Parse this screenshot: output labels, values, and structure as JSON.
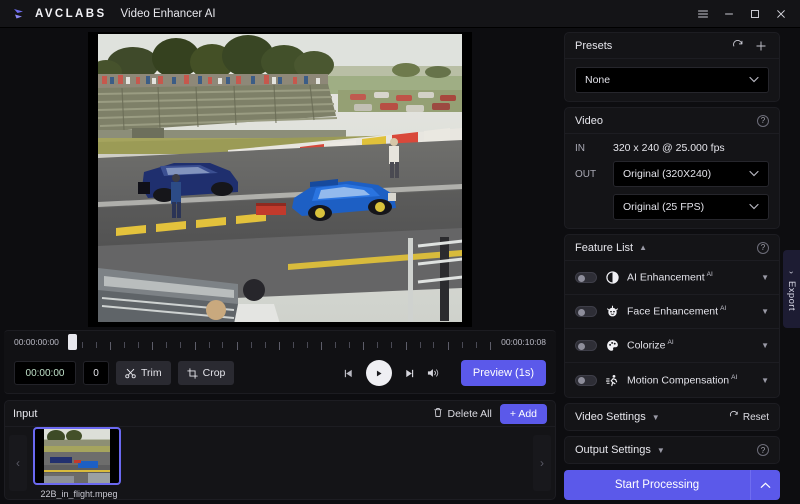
{
  "titlebar": {
    "brand": "AVCLABS",
    "logo_icon": "avclabs-logo-icon",
    "app_title": "Video Enhancer AI",
    "menu_icon": "hamburger-menu-icon",
    "minimize_icon": "minimize-icon",
    "maximize_icon": "maximize-icon",
    "close_icon": "close-icon"
  },
  "player": {
    "start_timecode": "00:00:00:00",
    "end_timecode": "00:00:10:08",
    "current_timecode": "00:00:00",
    "frame_number": "0",
    "trim_label": "Trim",
    "trim_icon": "scissors-icon",
    "crop_label": "Crop",
    "crop_icon": "crop-icon",
    "prev_frame_icon": "previous-frame-icon",
    "play_icon": "play-icon",
    "next_frame_icon": "next-frame-icon",
    "volume_icon": "volume-icon",
    "preview_label": "Preview (1s)",
    "playhead_icon": "playhead-handle-icon"
  },
  "input": {
    "title": "Input",
    "delete_all_label": "Delete All",
    "delete_icon": "trash-icon",
    "add_label": "+ Add",
    "prev_icon": "chevron-left-icon",
    "next_icon": "chevron-right-icon",
    "items": [
      {
        "filename": "22B_in_flight.mpeg"
      }
    ]
  },
  "presets": {
    "title": "Presets",
    "refresh_icon": "refresh-icon",
    "add_icon": "plus-icon",
    "selected": "None"
  },
  "video": {
    "title": "Video",
    "help_icon": "help-icon",
    "in_label": "IN",
    "in_value": "320 x 240 @ 25.000 fps",
    "in_resolution": "320 x 240",
    "in_fps": "25.000 fps",
    "out_label": "OUT",
    "out_resolution": "Original (320X240)",
    "out_framerate": "Original (25 FPS)",
    "chevron_icon": "chevron-down-icon"
  },
  "feature_list": {
    "title": "Feature List",
    "collapse_icon": "caret-up-icon",
    "help_icon": "help-icon",
    "items": [
      {
        "label": "AI Enhancement",
        "badge": "AI",
        "icon": "contrast-icon",
        "enabled": false
      },
      {
        "label": "Face Enhancement",
        "badge": "AI",
        "icon": "face-icon",
        "enabled": false
      },
      {
        "label": "Colorize",
        "badge": "AI",
        "icon": "palette-icon",
        "enabled": false
      },
      {
        "label": "Motion Compensation",
        "badge": "AI",
        "icon": "running-person-icon",
        "enabled": false
      }
    ]
  },
  "video_settings": {
    "title": "Video Settings",
    "chevron_icon": "caret-down-icon",
    "reset_label": "Reset",
    "reset_icon": "reset-icon"
  },
  "output_settings": {
    "title": "Output Settings",
    "chevron_icon": "caret-down-icon",
    "help_icon": "help-icon"
  },
  "start": {
    "label": "Start Processing",
    "chevron_icon": "caret-up-icon"
  },
  "export_tab": {
    "label": "Export",
    "chevron_icon": "chevron-icon"
  },
  "colors": {
    "accent": "#5b59ea",
    "panel": "#141417",
    "background": "#0d0d10",
    "titlebar": "#141417",
    "timecode_green": "#bfe0c8"
  }
}
